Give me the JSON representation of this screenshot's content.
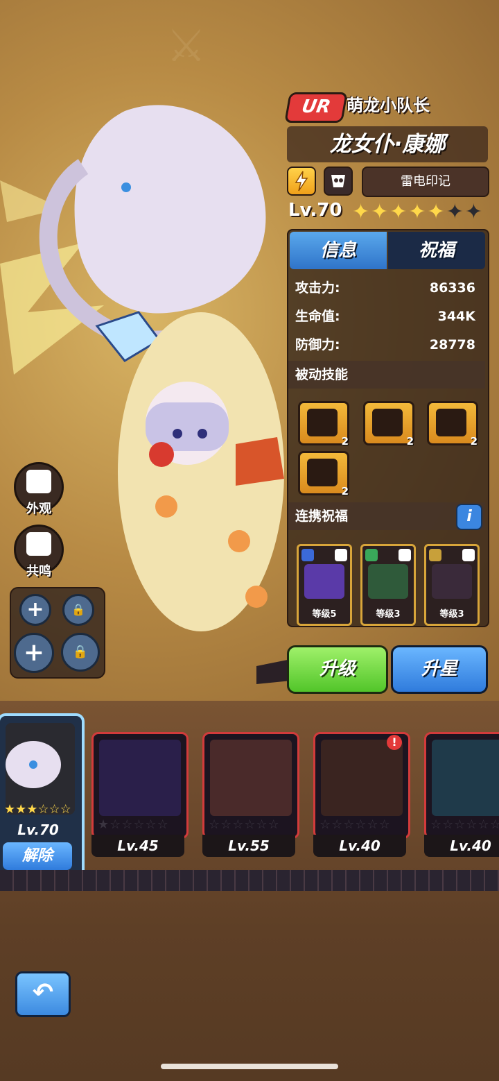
{
  "hero": {
    "rarity": "UR",
    "title": "萌龙小队长",
    "name": "龙女仆·康娜",
    "mark_label": "雷电印记",
    "level": "Lv.70",
    "stars_filled": 5,
    "stars_total": 7
  },
  "tabs": {
    "info": "信息",
    "blessing": "祝福"
  },
  "stats": [
    {
      "label": "攻击力:",
      "value": "86336"
    },
    {
      "label": "生命值:",
      "value": "344K"
    },
    {
      "label": "防御力:",
      "value": "28778"
    }
  ],
  "passive_section": "被动技能",
  "skills": [
    {
      "icon": "lightning-card-icon",
      "count": "2"
    },
    {
      "icon": "storm-icon",
      "count": "2"
    },
    {
      "icon": "dragon-head-icon",
      "count": "2"
    },
    {
      "icon": "horned-helmet-icon",
      "count": "2"
    }
  ],
  "bond_section": "连携祝福",
  "info_icon_label": "i",
  "bonds": [
    {
      "label": "等级5"
    },
    {
      "label": "等级3"
    },
    {
      "label": "等级3"
    }
  ],
  "buttons": {
    "upgrade": "升级",
    "star_up": "升星",
    "unequip": "解除",
    "back": "↶"
  },
  "side": {
    "appearance": "外观",
    "resonance": "共鸣"
  },
  "slots": [
    "+",
    "🔒",
    "+",
    "🔒"
  ],
  "roster": [
    {
      "level": "Lv.70",
      "stars": "★★★☆☆☆",
      "selected": true
    },
    {
      "level": "Lv.45",
      "stars": "★☆☆☆☆☆"
    },
    {
      "level": "Lv.55",
      "stars": "☆☆☆☆☆☆"
    },
    {
      "level": "Lv.40",
      "stars": "☆☆☆☆☆☆",
      "alert": "!"
    },
    {
      "level": "Lv.40",
      "stars": "☆☆☆☆☆☆"
    }
  ],
  "colors": {
    "rarity": "#e33a3a",
    "upgrade": "#6fdc3c",
    "star_up": "#3f8ee6",
    "card_border": "#d23b3b"
  }
}
